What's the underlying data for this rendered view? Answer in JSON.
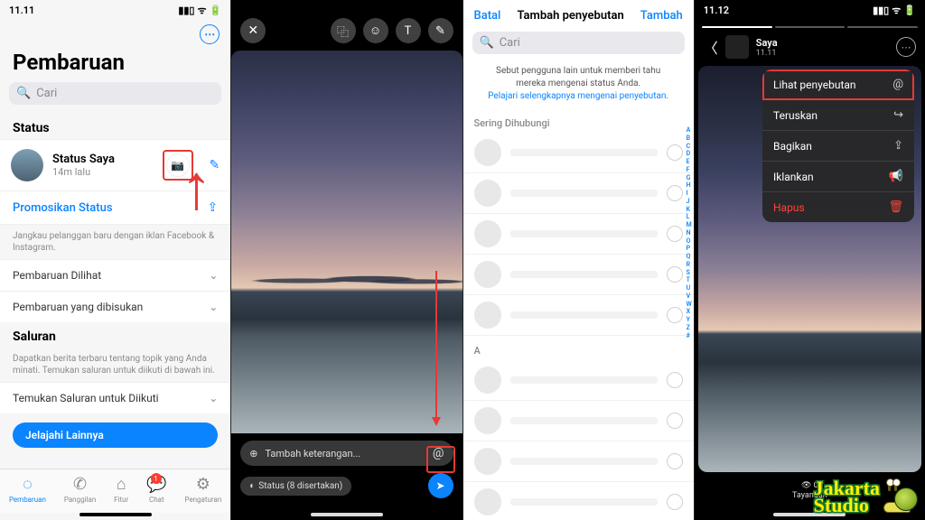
{
  "watermark": {
    "line1": "Jakarta",
    "line2": "Studio"
  },
  "panel1": {
    "time": "11.11",
    "title": "Pembaruan",
    "search_ph": "Cari",
    "status_header": "Status",
    "my_status": {
      "title": "Status Saya",
      "sub": "14m lalu"
    },
    "promo": {
      "label": "Promosikan Status",
      "desc": "Jangkau pelanggan baru dengan iklan Facebook & Instagram."
    },
    "rows": {
      "viewed": "Pembaruan Dilihat",
      "muted": "Pembaruan yang dibisukan"
    },
    "channels": {
      "header": "Saluran",
      "desc": "Dapatkan berita terbaru tentang topik yang Anda minati. Temukan saluran untuk diikuti di bawah ini.",
      "find": "Temukan Saluran untuk Diikuti",
      "explore": "Jelajahi Lainnya"
    },
    "tabs": {
      "updates": "Pembaruan",
      "calls": "Panggilan",
      "tools": "Fitur",
      "chat": "Chat",
      "settings": "Pengaturan",
      "chat_badge": "1"
    }
  },
  "panel2": {
    "caption_ph": "Tambah keterangan...",
    "status_chip": "Status (8 disertakan)"
  },
  "panel3": {
    "cancel": "Batal",
    "title": "Tambah penyebutan",
    "add": "Tambah",
    "search_ph": "Cari",
    "info": "Sebut pengguna lain untuk memberi tahu mereka mengenai status Anda.",
    "info_link": "Pelajari selengkapnya mengenai penyebutan.",
    "freq": "Sering Dihubungi",
    "section_a": "A",
    "alpha": [
      "A",
      "B",
      "C",
      "D",
      "E",
      "F",
      "G",
      "H",
      "I",
      "J",
      "K",
      "L",
      "M",
      "N",
      "O",
      "P",
      "Q",
      "R",
      "S",
      "T",
      "U",
      "V",
      "W",
      "X",
      "Y",
      "Z",
      "#"
    ]
  },
  "panel4": {
    "time": "11.12",
    "name": "Saya",
    "sub": "11.11",
    "menu": {
      "view": "Lihat penyebutan",
      "forward": "Teruskan",
      "share": "Bagikan",
      "advertise": "Iklankan",
      "delete": "Hapus"
    },
    "views": {
      "count": "0",
      "label": "Tayangan"
    }
  }
}
